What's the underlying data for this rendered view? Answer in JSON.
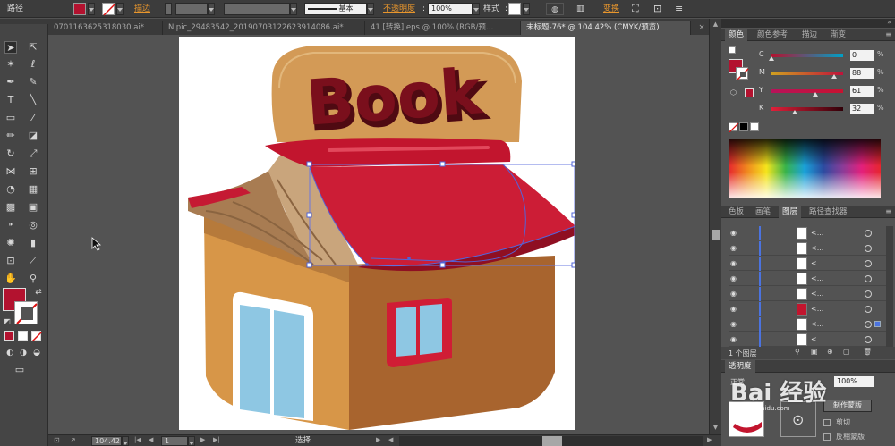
{
  "control_bar": {
    "object_type": "路径",
    "stroke_label": "描边",
    "stroke_style": "基本",
    "opacity_label": "不透明度",
    "opacity_value": "100%",
    "style_label": "样式",
    "transform_label": "变换",
    "fill_color": "#b3122f"
  },
  "tabs": [
    {
      "label": "0701163625318030.ai*",
      "active": false
    },
    {
      "label": "Nipic_29483542_20190703122623914086.ai*",
      "active": false
    },
    {
      "label": "41 [转换].eps @ 100% (RGB/预…",
      "active": false
    },
    {
      "label": "未标题-76* @ 104.42% (CMYK/预览)",
      "active": true
    }
  ],
  "artwork": {
    "sign_text": "Book"
  },
  "status_bar": {
    "zoom": "104.42",
    "page": "1",
    "tool_status": "选择"
  },
  "color_panel": {
    "tabs": [
      "颜色",
      "颜色参考",
      "描边",
      "渐变"
    ],
    "active_tab": 0,
    "channels": [
      {
        "letter": "C",
        "value": "0",
        "fraction": 0.0
      },
      {
        "letter": "M",
        "value": "88",
        "fraction": 0.88
      },
      {
        "letter": "Y",
        "value": "61",
        "fraction": 0.61
      },
      {
        "letter": "K",
        "value": "32",
        "fraction": 0.32
      }
    ],
    "fill_color": "#b3122f"
  },
  "layers_panel": {
    "tabs": [
      "色板",
      "画笔",
      "图层",
      "路径查找器"
    ],
    "active_tab": 2,
    "rows": [
      {
        "name": "<..."
      },
      {
        "name": "<..."
      },
      {
        "name": "<..."
      },
      {
        "name": "<..."
      },
      {
        "name": "<..."
      },
      {
        "name": "<..."
      },
      {
        "name": "<..."
      },
      {
        "name": "<..."
      }
    ],
    "footer": "1 个图层"
  },
  "transparency_panel": {
    "title": "透明度",
    "mode": "正常",
    "opacity": "100%",
    "make_mask": "制作蒙版",
    "clip": "剪切",
    "invert_mask": "反相蒙版"
  },
  "watermark": {
    "text": "Bai 经验",
    "sub": "jingyan.baidu.com"
  }
}
